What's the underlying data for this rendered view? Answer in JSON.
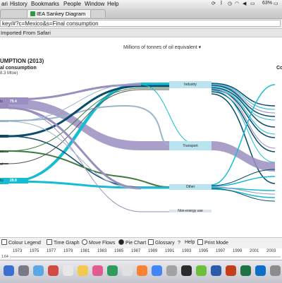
{
  "menubar": {
    "items": [
      "ari",
      "History",
      "Bookmarks",
      "People",
      "Window",
      "Help"
    ],
    "battery": "63%"
  },
  "tabs": [
    {
      "label": ""
    },
    {
      "label": "IEA Sankey Diagram"
    },
    {
      "label": ""
    }
  ],
  "url": "key/#?c=Mexico&s=Final consumption",
  "bookmarks": {
    "label": "Imported From Safari"
  },
  "chart": {
    "units_label": "Millions of tonnes of oil equivalent",
    "title": "UMPTION (2013)",
    "subtitle": "al consumption",
    "subtitle_value": "8.3 Mtoe)",
    "right_cut_label": "Co",
    "left_nodes": [
      {
        "label": "ts",
        "value": "79.4",
        "color": "#9a8ec0"
      },
      {
        "label": "",
        "value": "",
        "color": "#9a8ec0"
      },
      {
        "label": "",
        "value": "",
        "color": "#9ab5c9"
      },
      {
        "label": "ss",
        "value": "",
        "color": "#0b4b6b"
      },
      {
        "label": "ss",
        "value": "",
        "color": "#3c7a3f"
      },
      {
        "label": "al",
        "value": "",
        "color": "#555555"
      },
      {
        "label": "ity",
        "value": "28.8",
        "color": "#17bcd3"
      }
    ],
    "sectors": [
      {
        "label": "Industry"
      },
      {
        "label": "Transport"
      },
      {
        "label": "Other"
      },
      {
        "label": "Non-energy use"
      }
    ]
  },
  "chart_data": {
    "type": "sankey",
    "title": "UMPTION (2013)",
    "units": "Millions of tonnes of oil equivalent",
    "sources": [
      {
        "name": "ts",
        "value": 79.4
      },
      {
        "name": "ity",
        "value": 28.8
      }
    ],
    "targets": [
      "Industry",
      "Transport",
      "Other",
      "Non-energy use"
    ]
  },
  "toolbar": {
    "buttons": [
      "Colour Legend",
      "Time Graph",
      "Move Flows",
      "Pie Chart",
      "Glossary",
      "Help",
      "Print Mode"
    ]
  },
  "timeline": {
    "years": [
      "1973",
      "1975",
      "1977",
      "1979",
      "1981",
      "1983",
      "1985",
      "1987",
      "1989",
      "1991",
      "1993",
      "1995",
      "1997",
      "1999",
      "2001",
      "2003"
    ],
    "scale_label": "1.64",
    "position": 0.0
  }
}
